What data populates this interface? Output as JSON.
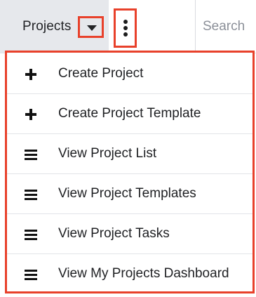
{
  "topbar": {
    "module_label": "Projects",
    "search_placeholder": "Search"
  },
  "icons": {
    "module_dropdown": "caret-down-icon",
    "more_actions": "kebab-vertical-icon"
  },
  "colors": {
    "highlight_outline": "#e8412b",
    "tab_background": "#e6e8ec",
    "menu_divider": "#e2e4e8",
    "text": "#1f2023"
  },
  "menu": {
    "items": [
      {
        "label": "Create Project",
        "icon": "plus-icon"
      },
      {
        "label": "Create Project Template",
        "icon": "plus-icon"
      },
      {
        "label": "View Project List",
        "icon": "list-icon"
      },
      {
        "label": "View Project Templates",
        "icon": "list-icon"
      },
      {
        "label": "View Project Tasks",
        "icon": "list-icon"
      },
      {
        "label": "View My Projects Dashboard",
        "icon": "list-icon"
      }
    ]
  }
}
